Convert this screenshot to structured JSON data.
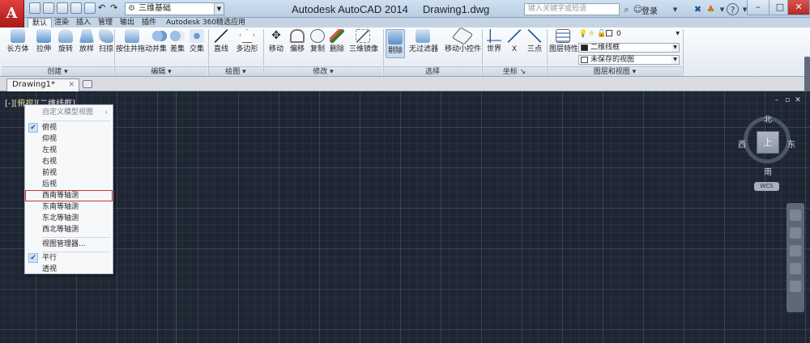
{
  "app": {
    "logo_letter": "A",
    "title": "Autodesk AutoCAD 2014",
    "document": "Drawing1.dwg"
  },
  "quick_access": {
    "workspace": "三维基础",
    "buttons": [
      "new-icon",
      "open-icon",
      "save-icon",
      "saveas-icon",
      "print-icon",
      "undo-icon",
      "redo-icon"
    ]
  },
  "infocenter": {
    "search_placeholder": "键入关键字或短语",
    "login": "登录"
  },
  "window_controls": {
    "minimize": "–",
    "maximize": "□",
    "close": "✕"
  },
  "ribbon": {
    "tabs": [
      "默认",
      "渲染",
      "插入",
      "管理",
      "输出",
      "插件",
      "Autodesk 360",
      "精选应用"
    ],
    "active_tab": "默认",
    "panels": {
      "create": {
        "title": "创建",
        "buttons": [
          "长方体",
          "拉伸",
          "旋转",
          "放样",
          "扫掠"
        ]
      },
      "edit": {
        "title": "编辑",
        "buttons": [
          "按住并拖动",
          "并集",
          "差集",
          "交集"
        ]
      },
      "draw": {
        "title": "绘图",
        "buttons": [
          "直线",
          "多边形"
        ]
      },
      "modify": {
        "title": "修改",
        "buttons": [
          "移动",
          "偏移",
          "复制",
          "删除",
          "三维镜像"
        ]
      },
      "selection": {
        "title": "选择",
        "buttons": [
          "剔除",
          "无过滤器",
          "移动小控件"
        ]
      },
      "coordinates": {
        "title": "坐标",
        "buttons": [
          "世界",
          "X",
          "三点"
        ]
      },
      "layers_view": {
        "title": "图层和视图",
        "button": "图层特性",
        "layer_value": "0",
        "visual_style": "二维线框",
        "view_state": "未保存的视图"
      }
    }
  },
  "document_tabs": {
    "active": "Drawing1*",
    "close": "✕"
  },
  "viewport": {
    "label_prefix": "[-]",
    "label_view": "[俯视]",
    "label_style": "[二维线框]",
    "controls": [
      "–",
      "▫",
      "✕"
    ]
  },
  "view_menu": {
    "header": "自定义模型视图",
    "header_arrow": "›",
    "items": [
      "俯视",
      "仰视",
      "左视",
      "右视",
      "前视",
      "后视",
      "西南等轴测",
      "东南等轴测",
      "东北等轴测",
      "西北等轴测"
    ],
    "checked": "俯视",
    "highlighted": "西南等轴测",
    "manager": "视图管理器...",
    "projection": [
      "平行",
      "透视"
    ],
    "projection_checked": "平行",
    "check_mark": "✔"
  },
  "viewcube": {
    "north": "北",
    "south": "南",
    "east": "东",
    "west": "西",
    "face": "上",
    "wcs": "WCS"
  },
  "colors": {
    "viewport_bg": "#1f2633",
    "ribbon_bg": "#e3e9f1",
    "highlight_outline": "#c0392b",
    "logo_red": "#c62828"
  }
}
